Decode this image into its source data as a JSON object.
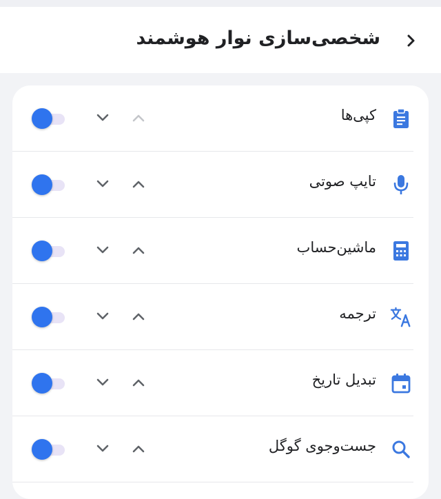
{
  "header": {
    "title": "شخصی‌سازی نوار هوشمند",
    "back_icon": "chevron-right-icon"
  },
  "colors": {
    "accent": "#2f74ee",
    "icon": "#3b78e0",
    "arrow": "#5f6368",
    "arrow_disabled": "#c4c6ca",
    "toggle_track": "#e8e3f6"
  },
  "items": [
    {
      "label": "کپی‌ها",
      "icon": "clipboard-icon",
      "up_enabled": false,
      "down_enabled": true,
      "enabled": true
    },
    {
      "label": "تایپ صوتی",
      "icon": "microphone-icon",
      "up_enabled": true,
      "down_enabled": true,
      "enabled": true
    },
    {
      "label": "ماشین‌حساب",
      "icon": "calculator-icon",
      "up_enabled": true,
      "down_enabled": true,
      "enabled": true
    },
    {
      "label": "ترجمه",
      "icon": "translate-icon",
      "up_enabled": true,
      "down_enabled": true,
      "enabled": true
    },
    {
      "label": "تبدیل تاریخ",
      "icon": "calendar-icon",
      "up_enabled": true,
      "down_enabled": true,
      "enabled": true
    },
    {
      "label": "جست‌وجوی گوگل",
      "icon": "search-icon",
      "up_enabled": true,
      "down_enabled": true,
      "enabled": true
    }
  ]
}
